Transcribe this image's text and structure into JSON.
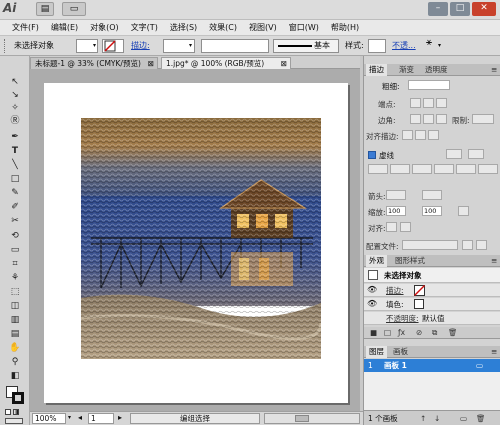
{
  "app": {
    "logo": "Ai"
  },
  "titlebar": {
    "buttons": [
      "▤",
      "▭"
    ],
    "win_controls": [
      "–",
      "□",
      "✕"
    ]
  },
  "menu": [
    "文件(F)",
    "编辑(E)",
    "对象(O)",
    "文字(T)",
    "选择(S)",
    "效果(C)",
    "视图(V)",
    "窗口(W)",
    "帮助(H)"
  ],
  "control_bar": {
    "selection": "未选择对象",
    "stroke_label": "描边:",
    "stroke_style": "基本",
    "style_label": "样式:",
    "opacity_label": "不透..."
  },
  "documents": [
    {
      "title": "未标题-1 @ 33% (CMYK/预览)",
      "close": "⊠",
      "active": false
    },
    {
      "title": "1.jpg* @ 100% (RGB/预览)",
      "close": "⊠",
      "active": true
    }
  ],
  "tools": [
    "↖",
    "↘",
    "✧",
    "Ⓡ",
    "✒",
    "T",
    "╲",
    "□",
    "✎",
    "✐",
    "✂",
    "⟲",
    "▭",
    "⌗",
    "⚘",
    "⬚",
    "◫",
    "▥",
    "▤",
    "✋",
    "⚲",
    "◧",
    "□",
    "⬛"
  ],
  "status": {
    "zoom": "100%",
    "page": "1",
    "mode": "编组选择"
  },
  "stroke_panel": {
    "tabs": [
      "描边",
      "渐变",
      "透明度"
    ],
    "weight_label": "粗细:",
    "cap_label": "端点:",
    "corner_label": "边角:",
    "limit_label": "限制:",
    "align_label": "对齐描边:",
    "dashed_label": "虚线",
    "arrow_label": "箭头:",
    "scale_label": "缩放:",
    "scale_left": "100",
    "scale_right": "100",
    "align2_label": "对齐:",
    "profile_label": "配置文件:"
  },
  "appearance_panel": {
    "tabs": [
      "外观",
      "图形样式"
    ],
    "header": "未选择对象",
    "rows": [
      {
        "label": "描边:"
      },
      {
        "label": "填色:"
      },
      {
        "label": "不透明度:",
        "value": "默认值"
      }
    ]
  },
  "layers_panel": {
    "tabs": [
      "图层",
      "画板"
    ],
    "row_index": "1",
    "row_name": "画板 1",
    "footer": "1 个画板"
  },
  "colors": {
    "accent": "#1e7bd4",
    "row_selected": "#2d7fd6",
    "stroke_none": "#d01010"
  }
}
